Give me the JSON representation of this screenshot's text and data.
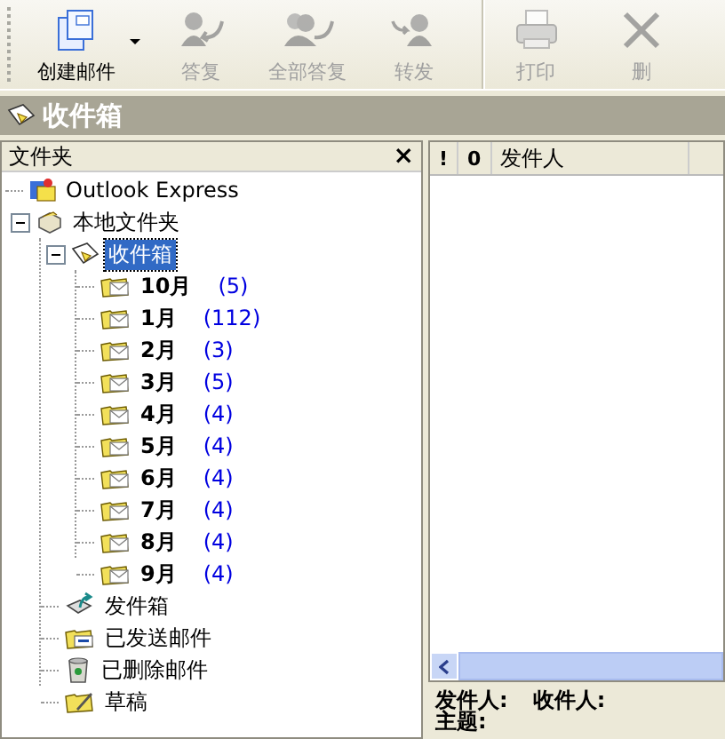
{
  "toolbar": [
    {
      "label": "创建邮件",
      "kind": "new",
      "disabled": false,
      "dropdown": true,
      "separator_before": false
    },
    {
      "label": "答复",
      "kind": "reply",
      "disabled": true,
      "dropdown": false,
      "separator_before": false
    },
    {
      "label": "全部答复",
      "kind": "replyall",
      "disabled": true,
      "dropdown": false,
      "separator_before": false
    },
    {
      "label": "转发",
      "kind": "forward",
      "disabled": true,
      "dropdown": false,
      "separator_before": false
    },
    {
      "label": "打印",
      "kind": "print",
      "disabled": true,
      "dropdown": false,
      "separator_before": true
    },
    {
      "label": "删",
      "kind": "delete",
      "disabled": true,
      "dropdown": false,
      "separator_before": false
    }
  ],
  "title_bar": {
    "title": "收件箱"
  },
  "folder_pane": {
    "title": "文件夹",
    "close": "×"
  },
  "tree": [
    {
      "label": "Outlook Express",
      "kind": "root",
      "selected": false
    },
    {
      "label": "本地文件夹",
      "kind": "local",
      "selected": false,
      "expanded": true,
      "children": [
        {
          "label": "收件箱",
          "kind": "inbox",
          "selected": true,
          "expanded": true,
          "children": [
            {
              "label": "10月",
              "kind": "folder",
              "count": "(5)",
              "bold": true,
              "selected": false
            },
            {
              "label": "1月",
              "kind": "folder",
              "count": "(112)",
              "bold": true,
              "selected": false
            },
            {
              "label": "2月",
              "kind": "folder",
              "count": "(3)",
              "bold": true,
              "selected": false
            },
            {
              "label": "3月",
              "kind": "folder",
              "count": "(5)",
              "bold": true,
              "selected": false
            },
            {
              "label": "4月",
              "kind": "folder",
              "count": "(4)",
              "bold": true,
              "selected": false
            },
            {
              "label": "5月",
              "kind": "folder",
              "count": "(4)",
              "bold": true,
              "selected": false
            },
            {
              "label": "6月",
              "kind": "folder",
              "count": "(4)",
              "bold": true,
              "selected": false
            },
            {
              "label": "7月",
              "kind": "folder",
              "count": "(4)",
              "bold": true,
              "selected": false
            },
            {
              "label": "8月",
              "kind": "folder",
              "count": "(4)",
              "bold": true,
              "selected": false
            },
            {
              "label": "9月",
              "kind": "folder",
              "count": "(4)",
              "bold": true,
              "selected": false
            }
          ]
        },
        {
          "label": "发件箱",
          "kind": "outbox",
          "selected": false
        },
        {
          "label": "已发送邮件",
          "kind": "sent",
          "selected": false
        },
        {
          "label": "已删除邮件",
          "kind": "deleted",
          "selected": false
        },
        {
          "label": "草稿",
          "kind": "drafts",
          "selected": false
        }
      ]
    }
  ],
  "message_list": {
    "columns": [
      "!",
      "0",
      "发件人"
    ]
  },
  "preview": {
    "from_label": "发件人:",
    "to_label": "收件人:",
    "subject_label": "主题:"
  }
}
